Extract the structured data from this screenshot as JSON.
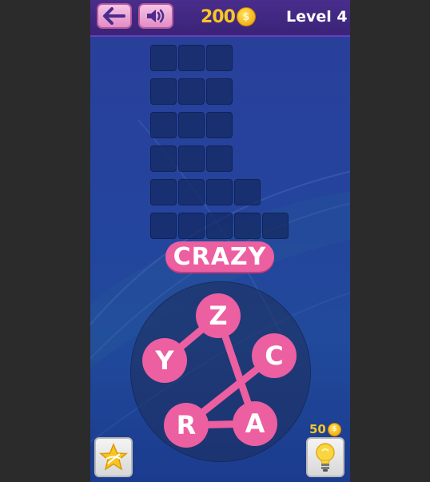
{
  "topbar": {
    "back_button": {
      "icon": "back-arrow-icon"
    },
    "sound_button": {
      "icon": "speaker-icon"
    },
    "coins": "200",
    "coin_symbol": "$",
    "level": "Level 4"
  },
  "puzzle": {
    "grid_rows": [
      3,
      3,
      3,
      3,
      4,
      5
    ],
    "current_word": "CRAZY"
  },
  "wheel": {
    "letters": [
      "Z",
      "C",
      "A",
      "R",
      "Y"
    ],
    "path": [
      "C",
      "R",
      "A",
      "Z",
      "Y"
    ]
  },
  "bottom": {
    "shuffle_button": {
      "icon": "star-shuffle-icon"
    },
    "hint_button": {
      "icon": "lightbulb-icon"
    },
    "hint_cost": "50",
    "coin_symbol": "$"
  },
  "colors": {
    "accent_pink": "#ec5fa1",
    "coin_gold": "#f9c623",
    "topbar_purple": "#3a2378"
  }
}
